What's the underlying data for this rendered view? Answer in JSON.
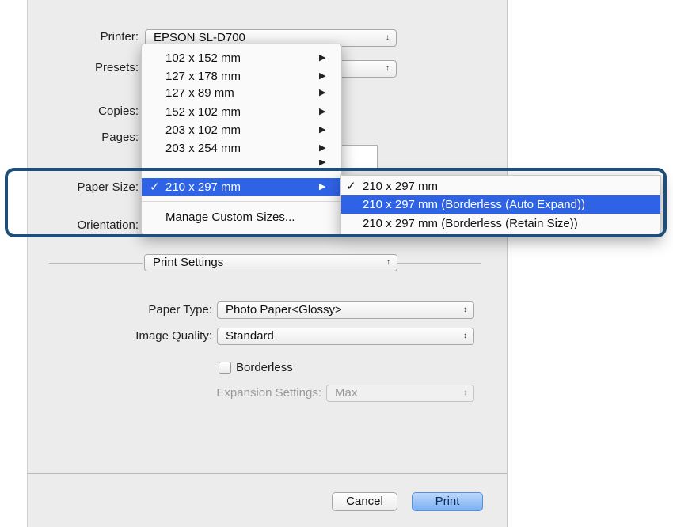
{
  "printer": {
    "label": "Printer:",
    "value": "EPSON SL-D700"
  },
  "presets": {
    "label": "Presets:"
  },
  "copies": {
    "label": "Copies:"
  },
  "pages": {
    "label": "Pages:"
  },
  "paper_size": {
    "label": "Paper Size:"
  },
  "orientation": {
    "label": "Orientation:"
  },
  "section": {
    "value": "Print Settings"
  },
  "paper_type": {
    "label": "Paper Type:",
    "value": "Photo Paper<Glossy>"
  },
  "image_quality": {
    "label": "Image Quality:",
    "value": "Standard"
  },
  "borderless": {
    "label": "Borderless",
    "checked": false
  },
  "expansion": {
    "label": "Expansion Settings:",
    "value": "Max",
    "enabled": false
  },
  "paper_menu": {
    "items": [
      "102 x 152 mm",
      "127 x 178 mm",
      "127 x 89 mm",
      "152 x 102 mm",
      "203 x 102 mm",
      "203 x 254 mm",
      "210 x 297 mm"
    ],
    "checkmark": "✓",
    "manage": "Manage Custom Sizes..."
  },
  "submenu": {
    "checkmark": "✓",
    "items": [
      "210 x 297 mm",
      "210 x 297 mm (Borderless (Auto Expand))",
      "210 x 297 mm (Borderless (Retain Size))"
    ]
  },
  "buttons": {
    "cancel": "Cancel",
    "print": "Print"
  },
  "colors": {
    "selection": "#2f63e6",
    "highlight_frame": "#1f4e7a",
    "panel_bg": "#ececec"
  }
}
